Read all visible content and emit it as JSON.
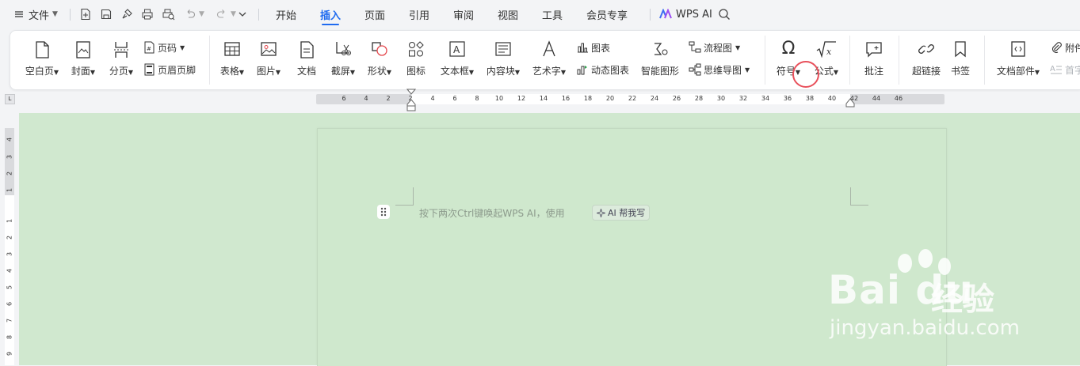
{
  "menubar": {
    "file_menu": "文件",
    "tabs": [
      "开始",
      "插入",
      "页面",
      "引用",
      "审阅",
      "视图",
      "工具",
      "会员专享"
    ],
    "active_tab": "插入",
    "wps_ai": "WPS AI"
  },
  "ribbon": {
    "blank_page": "空白页",
    "cover": "封面",
    "section": "分页",
    "page_number": "页码",
    "header_footer": "页眉页脚",
    "table": "表格",
    "picture": "图片",
    "document": "文档",
    "screenshot": "截屏",
    "shape": "形状",
    "icon": "图标",
    "textbox": "文本框",
    "content_block": "内容块",
    "wordart": "艺术字",
    "chart": "图表",
    "dynamic_chart": "动态图表",
    "smart_graphic": "智能图形",
    "flowchart": "流程图",
    "mindmap": "思维导图",
    "symbol": "符号",
    "formula": "公式",
    "comment": "批注",
    "hyperlink": "超链接",
    "bookmark": "书签",
    "doc_parts": "文档部件",
    "attachment": "附件",
    "firstletter": "首字"
  },
  "ruler": {
    "h_ticks": [
      "6",
      "4",
      "2",
      "2",
      "4",
      "6",
      "8",
      "10",
      "12",
      "14",
      "16",
      "18",
      "20",
      "22",
      "24",
      "26",
      "28",
      "30",
      "32",
      "34",
      "36",
      "38",
      "40",
      "42",
      "44",
      "46"
    ],
    "v_ticks": [
      "4",
      "3",
      "2",
      "1",
      "1",
      "2",
      "3",
      "4",
      "5",
      "6",
      "7",
      "8",
      "9"
    ]
  },
  "document": {
    "hint": "按下两次Ctrl键唤起WPS AI，使用",
    "ai_chip": "AI 帮我写"
  },
  "watermark": {
    "name": "Bai du",
    "cn": "经验",
    "url": "jingyan.baidu.com"
  },
  "colors": {
    "accent": "#1f6bf0",
    "doc_background": "#d0e8cf",
    "highlight_circle": "#e8505b"
  }
}
